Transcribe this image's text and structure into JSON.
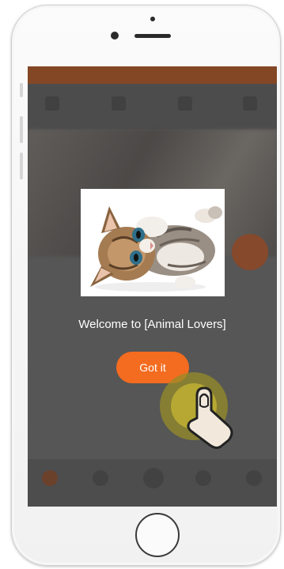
{
  "popup": {
    "welcome_text": "Welcome to [Animal Lovers]",
    "button_label": "Got it",
    "image_icon": "kitten-photo"
  },
  "colors": {
    "accent": "#f36c1f",
    "app_bar": "#b0541f",
    "overlay": "#6a6a6a",
    "tap_ring": "#c2b33a"
  },
  "icons": {
    "tap_indicator": "tap-finger-icon"
  }
}
